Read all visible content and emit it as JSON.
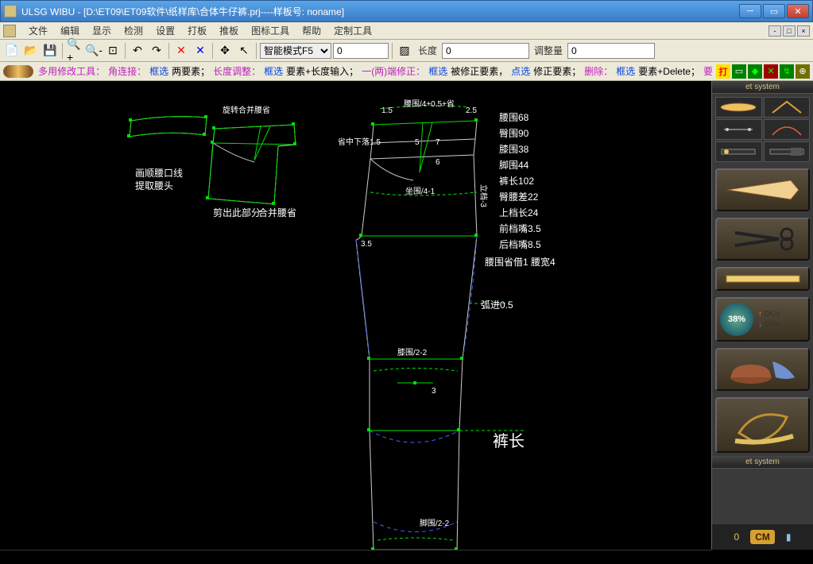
{
  "window": {
    "title": "ULSG WIBU - [D:\\ET09\\ET09软件\\纸样库\\合体牛仔裤.prj----样板号: noname]"
  },
  "menu": {
    "items": [
      "文件",
      "编辑",
      "显示",
      "检测",
      "设置",
      "打板",
      "推板",
      "图标工具",
      "帮助",
      "定制工具"
    ]
  },
  "toolbar1": {
    "mode_combo": "智能模式F5",
    "value1": "0",
    "length_label": "长度",
    "length_value": "0",
    "adjust_label": "调整量",
    "adjust_value": "0"
  },
  "cmdbar": {
    "p1": "多用修改工具：",
    "p2": "角连接：",
    "p2b": "框选",
    "p2c": "两要素；",
    "p3": "长度调整：",
    "p3b": "框选",
    "p3c": "要素+长度输入；",
    "p4": "一(两)端修正：",
    "p4b": "框选",
    "p4c": "被修正要素，",
    "p4d": "点选",
    "p4e": "修正要素；",
    "p5": "删除：",
    "p5b": "框选",
    "p5c": "要素+Delete；",
    "p6": "要",
    "end_label": "打"
  },
  "canvas": {
    "left_notes": [
      "画顺腰口线",
      "提取腰头"
    ],
    "piece_label1": "旋转合并腰省",
    "piece_label2": "剪出此部分",
    "piece_label3": "合并腰省",
    "top_dim1": "1.5",
    "top_dim2": "腰围/4+0.5+省",
    "top_dim3": "2.5",
    "mid_dim1": "省中下落1.5",
    "mid_dim2": "5",
    "mid_dim3": "7",
    "mid_dim4": "6",
    "hip_dim": "坐围/4-1",
    "side_dim": "立档-3",
    "left_val": "3.5",
    "measurements": [
      "腰围68",
      "臀围90",
      "膝围38",
      "脚围44",
      "裤长102",
      "臀腰差22",
      "上档长24",
      "前档嘴3.5",
      "后档嘴8.5"
    ],
    "note2": "腰围省借1  腰宽4",
    "arc_note": "弧进0.5",
    "knee_note": "膝围/2-2",
    "val3": "3",
    "length_note": "裤长",
    "foot_note": "脚围/2-2"
  },
  "rpanel": {
    "header": "et system",
    "footer": "et system",
    "percent": "38%",
    "speed1": "0K/s",
    "speed2": "0K/s",
    "unit1": "0",
    "unit2": "CM"
  }
}
